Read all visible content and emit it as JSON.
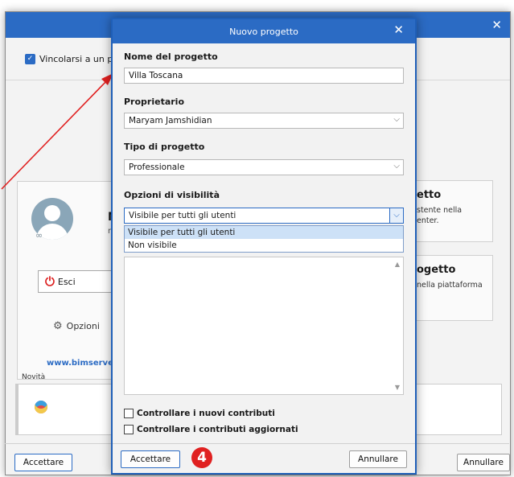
{
  "background_window": {
    "checkbox_label": "Vincolarsi a un prog",
    "user_initial": "M",
    "user_small": "m",
    "logout_label": "Esci",
    "options_label": "Opzioni",
    "link_text": "www.bimserver.c",
    "right_card_1": {
      "title": "etto",
      "desc_line1": "stente nella",
      "desc_line2": "enter."
    },
    "right_card_2": {
      "title": "ogetto",
      "desc_line1": "nella piattaforma"
    },
    "news_label": "Novità",
    "accept_label": "Accettare",
    "cancel_label": "Annullare"
  },
  "dialog": {
    "title": "Nuovo progetto",
    "project_name": {
      "label": "Nome del progetto",
      "value": "Villa Toscana"
    },
    "owner": {
      "label": "Proprietario",
      "value": "Maryam Jamshidian"
    },
    "project_type": {
      "label": "Tipo di progetto",
      "value": "Professionale"
    },
    "visibility": {
      "label": "Opzioni di visibilità",
      "value": "Visibile per tutti gli utenti",
      "options": [
        "Visibile per tutti gli utenti",
        "Non visibile"
      ]
    },
    "check_new_contributions": "Controllare i nuovi contributi",
    "check_updated_contributions": "Controllare i contributi aggiornati",
    "accept_label": "Accettare",
    "cancel_label": "Annullare",
    "step_number": "4"
  },
  "colors": {
    "accent": "#2b6bc4",
    "annotation": "#e02020"
  }
}
